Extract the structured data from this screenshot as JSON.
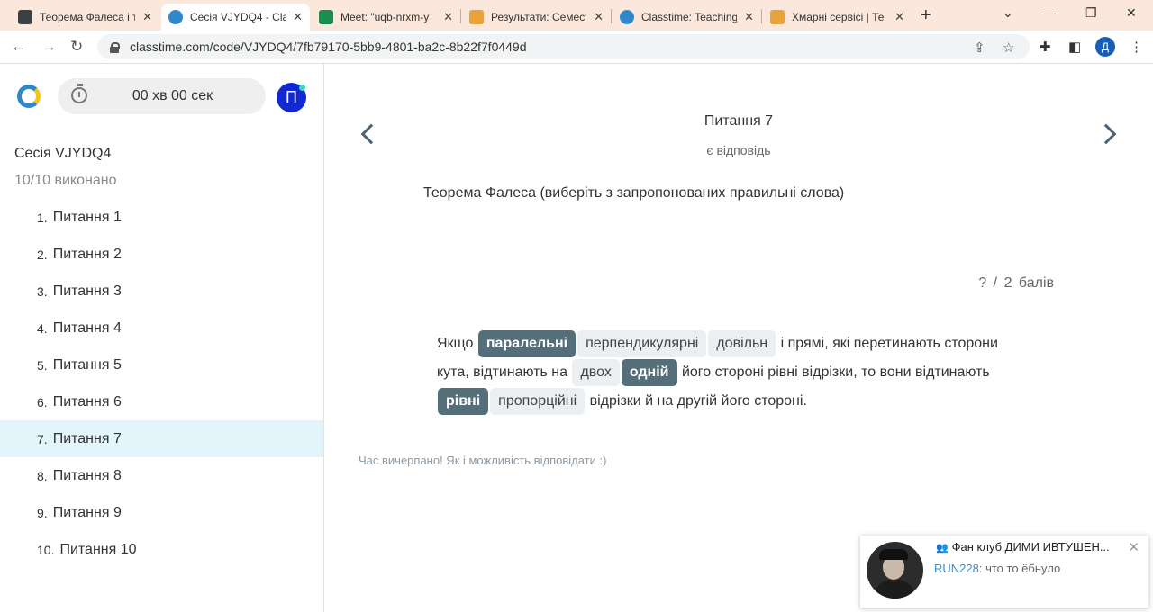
{
  "browser": {
    "tabs": [
      {
        "title": "Теорема Фалеса і т",
        "favicon_color": "#3c4043",
        "icon": "slides-icon"
      },
      {
        "title": "Сесія VJYDQ4 - Cla",
        "favicon_color": "#2e88c9",
        "icon": "classtime-icon"
      },
      {
        "title": "Meet: \"uqb-nrxm-y",
        "favicon_color": "#1a8e4f",
        "icon": "meet-icon"
      },
      {
        "title": "Результати: Семест",
        "favicon_color": "#e8a33d",
        "icon": "moodle-icon"
      },
      {
        "title": "Classtime: Teaching",
        "favicon_color": "#2e88c9",
        "icon": "classtime-icon"
      },
      {
        "title": "Хмарні сервісі | Те",
        "favicon_color": "#e8a33d",
        "icon": "moodle-icon"
      }
    ],
    "active_tab_index": 1,
    "url": "classtime.com/code/VJYDQ4/7fb79170-5bb9-4801-ba2c-8b22f7f0449d",
    "profile_initial": "Д"
  },
  "sidebar": {
    "timer": "00 хв 00 сек",
    "avatar_initial": "П",
    "session": "Сесія VJYDQ4",
    "done": "10/10 виконано",
    "selected_index": 6,
    "questions": [
      {
        "num": "1.",
        "label": "Питання 1"
      },
      {
        "num": "2.",
        "label": "Питання 2"
      },
      {
        "num": "3.",
        "label": "Питання 3"
      },
      {
        "num": "4.",
        "label": "Питання 4"
      },
      {
        "num": "5.",
        "label": "Питання 5"
      },
      {
        "num": "6.",
        "label": "Питання 6"
      },
      {
        "num": "7.",
        "label": "Питання 7"
      },
      {
        "num": "8.",
        "label": "Питання 8"
      },
      {
        "num": "9.",
        "label": "Питання 9"
      },
      {
        "num": "10.",
        "label": "Питання 10"
      }
    ]
  },
  "main": {
    "title": "Питання 7",
    "status": "є відповідь",
    "question": "Теорема Фалеса (виберіть з запропонованих правильні слова)",
    "points": "? / 2 балів",
    "answer": {
      "w_if": "Якщо",
      "c1": "паралельні",
      "c2": "перпендикулярні",
      "c3": "довільн",
      "t1": "і прямі, які перетинають сторони кута, відтинають на",
      "c4": "двох",
      "c5": "одній",
      "t2": "його стороні рівні відрізки, то вони відтинають",
      "c6": "рівні",
      "c7": "пропорційні",
      "t3": "відрізки й на другій його стороні."
    },
    "timeout": "Час вичерпано! Як і можливість відповідати :)"
  },
  "notification": {
    "title": "Фан клуб ДИМИ ИВТУШЕН...",
    "author": "RUN228:",
    "message": "что то ёбнуло"
  }
}
